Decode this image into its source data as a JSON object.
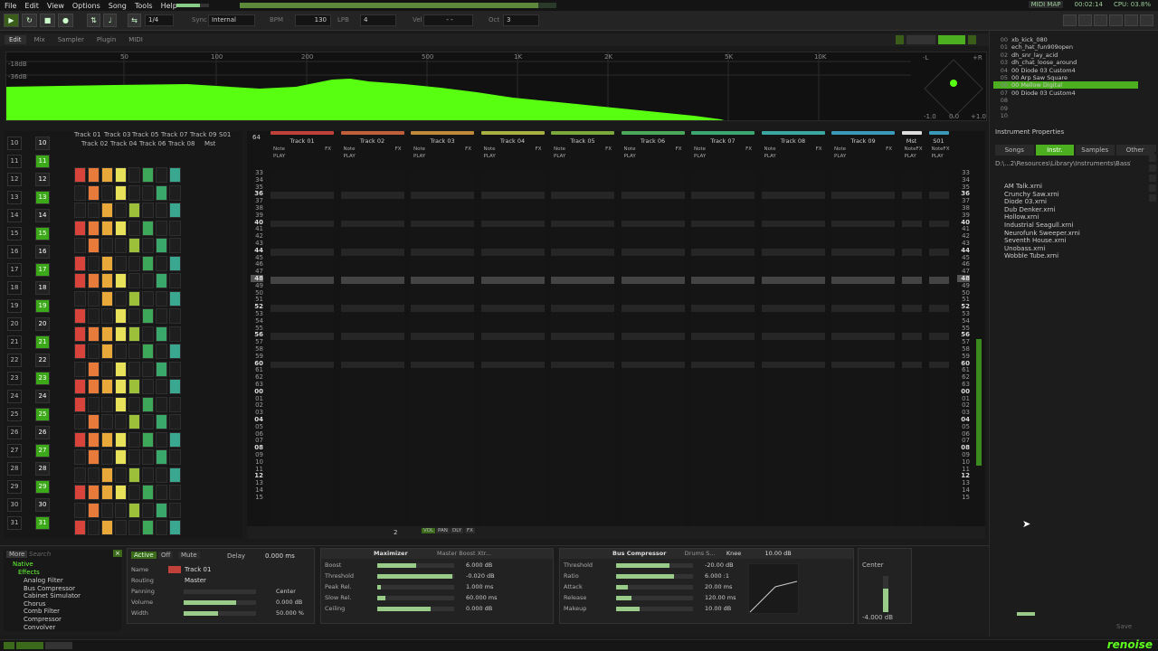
{
  "menu": [
    "File",
    "Edit",
    "View",
    "Options",
    "Song",
    "Tools",
    "Help"
  ],
  "status": {
    "midi": "MIDI MAP",
    "time": "00:02:14",
    "cpu": "CPU: 03.8%"
  },
  "toolbar": {
    "pattern": "1/4",
    "sync_label": "Sync",
    "sync": "Internal",
    "bpm_label": "BPM",
    "bpm": "130",
    "lpb_label": "LPB",
    "lpb": "4",
    "vel_label": "Vel",
    "vel": "- -",
    "oct_label": "Oct",
    "oct": "3"
  },
  "tabs": [
    "Edit",
    "Mix",
    "Sampler",
    "Plugin",
    "MIDI"
  ],
  "spectrum": {
    "ticks": [
      "50",
      "100",
      "200",
      "500",
      "1K",
      "2K",
      "5K",
      "10K"
    ],
    "db_top": "-18dB",
    "db_bot": "-36dB",
    "pan_l": "-L",
    "pan_r": "+R",
    "scale": [
      "-1.0",
      "0.0",
      "+1.0"
    ]
  },
  "instruments": [
    {
      "n": "00",
      "name": "xb_kick_080"
    },
    {
      "n": "01",
      "name": "ech_hat_fun909open"
    },
    {
      "n": "02",
      "name": "dh_snr_lay_acid"
    },
    {
      "n": "03",
      "name": "dh_chat_loose_around"
    },
    {
      "n": "04",
      "name": "00 Diode 03 Custom4"
    },
    {
      "n": "05",
      "name": "00 Arp Saw Square"
    },
    {
      "n": "06",
      "name": "00 Mellow Digital"
    },
    {
      "n": "07",
      "name": "00 Diode 03 Custom4"
    },
    {
      "n": "08",
      "name": ""
    },
    {
      "n": "09",
      "name": ""
    },
    {
      "n": "10",
      "name": ""
    }
  ],
  "inst_props": "Instrument Properties",
  "browser_tabs": [
    "Songs",
    "Instr.",
    "Samples",
    "Other"
  ],
  "browser_path": "D:\\...2\\Resources\\Library\\Instruments\\Bass\\",
  "browser_files": [
    "AM Talk.xrni",
    "Crunchy Saw.xrni",
    "Diode 03.xrni",
    "Dub Denker.xrni",
    "Hollow.xrni",
    "Industrial Seagull.xrni",
    "Neurofunk Sweeper.xrni",
    "Seventh House.xrni",
    "Unobass.xrni",
    "Wobble Tube.xrni"
  ],
  "matrix": {
    "headers_top": [
      "Track 01",
      "Track 03",
      "Track 05",
      "Track 07",
      "Track 09",
      "S01"
    ],
    "headers_bot": [
      "Track 02",
      "Track 04",
      "Track 06",
      "Track 08",
      "Mst"
    ],
    "seq": [
      "10",
      "11",
      "12",
      "13",
      "14",
      "15",
      "16",
      "17",
      "18",
      "19",
      "20",
      "21",
      "22",
      "23",
      "24",
      "25",
      "26",
      "27",
      "28",
      "29",
      "30",
      "31"
    ],
    "pat": [
      "10",
      "11",
      "12",
      "13",
      "14",
      "15",
      "16",
      "17",
      "18",
      "19",
      "20",
      "21",
      "22",
      "23",
      "24",
      "25",
      "26",
      "27",
      "28",
      "29",
      "30",
      "31"
    ]
  },
  "tracks": [
    {
      "name": "Track 01",
      "color": "#c0403a"
    },
    {
      "name": "Track 02",
      "color": "#c0603a"
    },
    {
      "name": "Track 03",
      "color": "#c08a3a"
    },
    {
      "name": "Track 04",
      "color": "#a8b040"
    },
    {
      "name": "Track 05",
      "color": "#7aa83a"
    },
    {
      "name": "Track 06",
      "color": "#4aa85a"
    },
    {
      "name": "Track 07",
      "color": "#3aa870"
    },
    {
      "name": "Track 08",
      "color": "#3aa8a0"
    },
    {
      "name": "Track 09",
      "color": "#3a98b8"
    },
    {
      "name": "Mst",
      "color": "#dddddd"
    },
    {
      "name": "S01",
      "color": "#3a98b8"
    }
  ],
  "track_sub": {
    "note": "Note",
    "fx": "FX",
    "play": "PLAY"
  },
  "pattern_num": "64",
  "rows": [
    "33",
    "34",
    "35",
    "36",
    "37",
    "38",
    "39",
    "40",
    "41",
    "42",
    "43",
    "44",
    "45",
    "46",
    "47",
    "48",
    "49",
    "50",
    "51",
    "52",
    "53",
    "54",
    "55",
    "56",
    "57",
    "58",
    "59",
    "60",
    "61",
    "62",
    "63",
    "00",
    "01",
    "02",
    "03",
    "04",
    "05",
    "06",
    "07",
    "08",
    "09",
    "10",
    "11",
    "12",
    "13",
    "14",
    "15"
  ],
  "bottombar": {
    "oct": "2",
    "labels": [
      "VOL",
      "PAN",
      "DLY",
      "FX"
    ]
  },
  "dsp_list": {
    "more": "More",
    "search": "Search",
    "native": "Native",
    "effects": "Effects",
    "items": [
      "Analog Filter",
      "Bus Compressor",
      "Cabinet Simulator",
      "Chorus",
      "Comb Filter",
      "Compressor",
      "Convolver"
    ]
  },
  "trackdsp": {
    "active": "Active",
    "off": "Off",
    "mute": "Mute",
    "delay_label": "Delay",
    "delay": "0.000 ms",
    "name_label": "Name",
    "name": "Track 01",
    "routing_label": "Routing",
    "routing": "Master",
    "panning_label": "Panning",
    "panning": "Center",
    "volume_label": "Volume",
    "volume": "0.000 dB",
    "width_label": "Width",
    "width": "50.000 %"
  },
  "maximizer": {
    "title": "Maximizer",
    "preset": "Master Boost Xtr...",
    "params": [
      {
        "l": "Boost",
        "v": "6.000 dB",
        "f": 0.5
      },
      {
        "l": "Threshold",
        "v": "-0.020 dB",
        "f": 0.98
      },
      {
        "l": "Peak Rel.",
        "v": "1.000 ms",
        "f": 0.05
      },
      {
        "l": "Slow Rel.",
        "v": "60.000 ms",
        "f": 0.1
      },
      {
        "l": "Ceiling",
        "v": "0.000 dB",
        "f": 0.7
      }
    ]
  },
  "buscomp": {
    "title": "Bus Compressor",
    "preset": "Drums S...",
    "knee_label": "Knee",
    "knee": "10.00 dB",
    "params": [
      {
        "l": "Threshold",
        "v": "-20.00 dB",
        "f": 0.7
      },
      {
        "l": "Ratio",
        "v": "6.000 :1",
        "f": 0.75
      },
      {
        "l": "Attack",
        "v": "20.00 ms",
        "f": 0.15
      },
      {
        "l": "Release",
        "v": "120.00 ms",
        "f": 0.2
      },
      {
        "l": "Makeup",
        "v": "10.00 dB",
        "f": 0.3
      }
    ]
  },
  "master": {
    "pan": "Center",
    "vol": "-4.000 dB"
  },
  "save": "Save",
  "brand": "renoise",
  "colors": {
    "accent": "#5dff1f"
  }
}
